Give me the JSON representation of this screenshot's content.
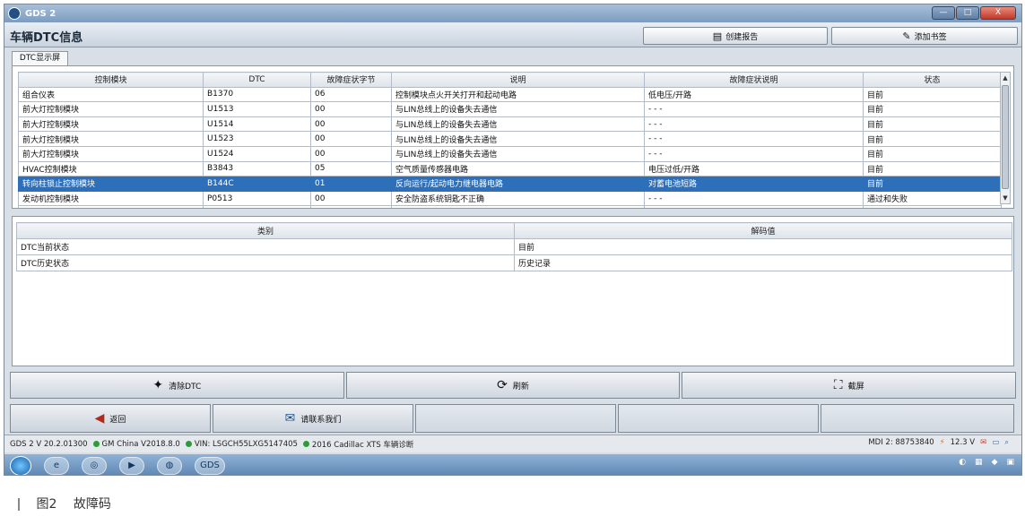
{
  "window": {
    "title": "GDS 2",
    "controls": [
      "—",
      "□",
      "X"
    ]
  },
  "header": {
    "title": "车辆DTC信息",
    "create_report": "创建报告",
    "add_bookmark": "添加书签"
  },
  "tab": {
    "label": "DTC显示屏"
  },
  "dtc_table": {
    "columns": [
      "控制模块",
      "DTC",
      "故障症状字节",
      "说明",
      "故障症状说明",
      "状态"
    ],
    "rows": [
      [
        "组合仪表",
        "B1370",
        "06",
        "控制模块点火开关打开和起动电路",
        "低电压/开路",
        "目前"
      ],
      [
        "前大灯控制模块",
        "U1513",
        "00",
        "与LIN总线上的设备失去通信",
        "- - -",
        "目前"
      ],
      [
        "前大灯控制模块",
        "U1514",
        "00",
        "与LIN总线上的设备失去通信",
        "- - -",
        "目前"
      ],
      [
        "前大灯控制模块",
        "U1523",
        "00",
        "与LIN总线上的设备失去通信",
        "- - -",
        "目前"
      ],
      [
        "前大灯控制模块",
        "U1524",
        "00",
        "与LIN总线上的设备失去通信",
        "- - -",
        "目前"
      ],
      [
        "HVAC控制模块",
        "B3843",
        "05",
        "空气质量传感器电路",
        "电压过低/开路",
        "目前"
      ],
      [
        "转向柱锁止控制模块",
        "B144C",
        "01",
        "反向运行/起动电力继电器电路",
        "对蓄电池短路",
        "目前"
      ],
      [
        "发动机控制模块",
        "P0513",
        "00",
        "安全防盗系统钥匙不正确",
        "- - -",
        "通过和失败"
      ]
    ],
    "selected_row": 6
  },
  "status_table": {
    "columns": [
      "类别",
      "解码值"
    ],
    "rows": [
      [
        "DTC当前状态",
        "目前"
      ],
      [
        "DTC历史状态",
        "历史记录"
      ]
    ]
  },
  "actions": {
    "clear_dtc": "清除DTC",
    "refresh": "刷新",
    "snapshot": "截屏"
  },
  "nav": {
    "back": "返回",
    "contact_us": "请联系我们"
  },
  "info_bar": {
    "version": "GDS 2 V 20.2.01300",
    "region": "GM China V2018.8.0",
    "vin": "VIN: LSGCH55LXG5147405",
    "vehicle": "2016 Cadillac XTS 车辆诊断",
    "mdi": "MDI 2: 88753840",
    "voltage": "12.3 V"
  },
  "taskbar": {
    "gds_label": "GDS"
  },
  "caption": {
    "label": "图2",
    "text": "故障码"
  }
}
